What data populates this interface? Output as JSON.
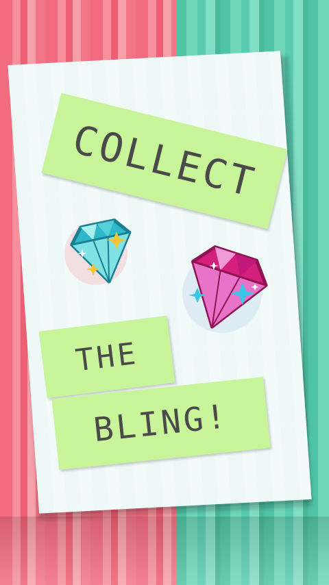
{
  "title_lines": [
    "COLLECT",
    "THE",
    "BLING!"
  ],
  "colors": {
    "left_stripe": "#f26b7f",
    "right_stripe": "#4fc3a6",
    "card": "#eef8f6",
    "tag": "#c9f59a",
    "text": "#4a4a4a",
    "gem_cyan": "#2fb8c9",
    "gem_pink": "#d51f7c"
  },
  "icons": [
    "cyan-diamond-icon",
    "pink-diamond-icon",
    "sparkle-icon"
  ]
}
